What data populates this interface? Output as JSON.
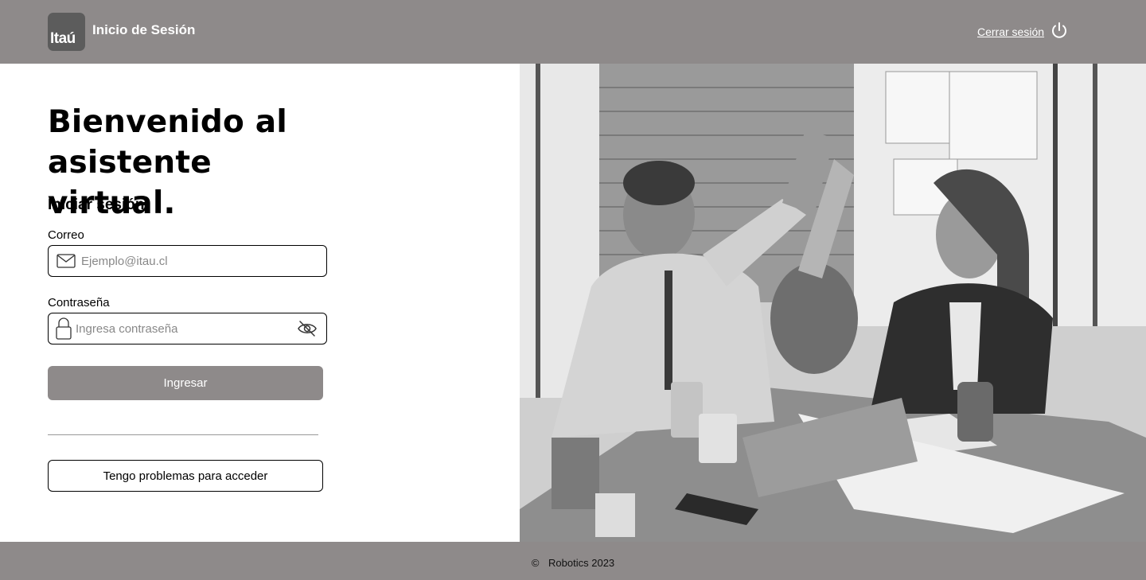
{
  "header": {
    "logo_text": "Itaú",
    "title": "Inicio de Sesión",
    "logout_label": "Cerrar sesión",
    "logout_icon": "power-icon"
  },
  "main": {
    "welcome_title": "Bienvenido al asistente virtual.",
    "login_heading": "Iniciar sesión",
    "email": {
      "label": "Correo",
      "placeholder": "Ejemplo@itau.cl",
      "value": "",
      "icon": "mail-icon"
    },
    "password": {
      "label": "Contraseña",
      "placeholder": "Ingresa contraseña",
      "value": "",
      "icon": "lock-icon",
      "toggle_icon": "eye-off-icon"
    },
    "submit_label": "Ingresar",
    "help_label": "Tengo problemas para acceder"
  },
  "footer": {
    "copyright_symbol": "©",
    "text": "Robotics 2023"
  },
  "colors": {
    "header_bg": "#8e8a8a",
    "footer_bg": "#8e8a8a",
    "primary_button": "#8e8a8a",
    "logo_bg": "#5c5c5c"
  }
}
